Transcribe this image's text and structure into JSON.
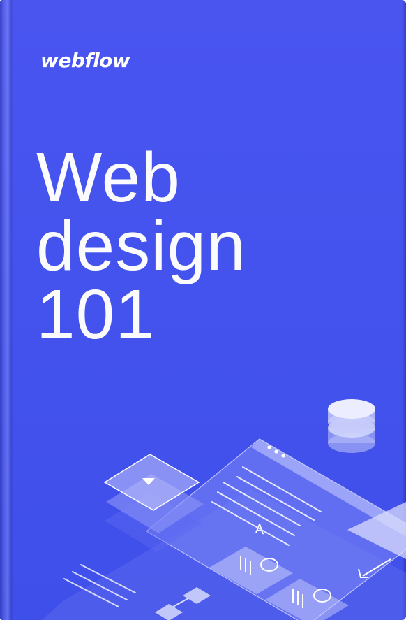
{
  "cover": {
    "logo": "webflow",
    "title_lines": [
      "Web",
      "design",
      "101"
    ]
  },
  "colors": {
    "background": "#4453ee",
    "text": "#ffffff",
    "illustration_tint": "#c9cdfa"
  },
  "illustration": {
    "icons": [
      "play-button-card-icon",
      "database-cylinder-icon",
      "browser-window-icon",
      "text-lines-icon",
      "media-card-icon",
      "arrow-icon"
    ]
  }
}
